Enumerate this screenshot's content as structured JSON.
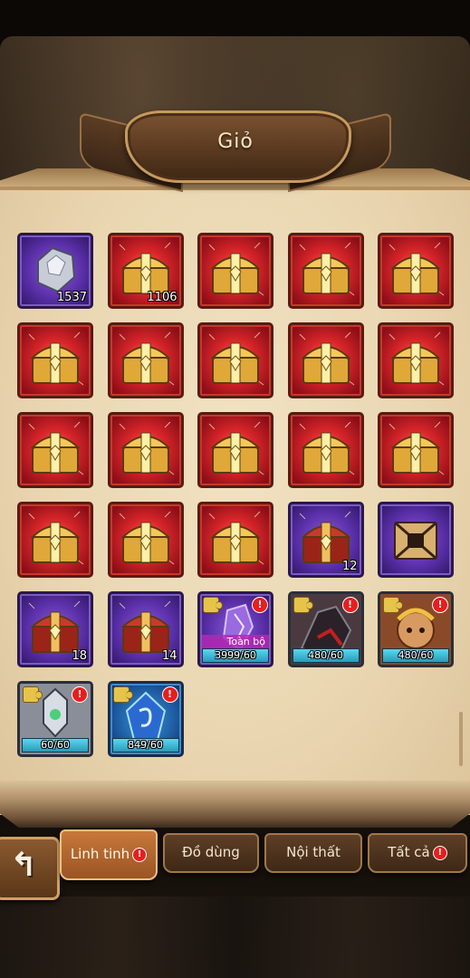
{
  "title": "Giỏ",
  "items": [
    {
      "kind": "gem",
      "count": "1537"
    },
    {
      "kind": "gold-chest",
      "count": "1106"
    },
    {
      "kind": "gold-chest",
      "count": ""
    },
    {
      "kind": "gold-chest",
      "count": ""
    },
    {
      "kind": "gold-chest",
      "count": ""
    },
    {
      "kind": "gold-chest",
      "count": ""
    },
    {
      "kind": "gold-chest",
      "count": ""
    },
    {
      "kind": "gold-chest",
      "count": ""
    },
    {
      "kind": "gold-chest",
      "count": ""
    },
    {
      "kind": "gold-chest",
      "count": ""
    },
    {
      "kind": "gold-chest",
      "count": ""
    },
    {
      "kind": "gold-chest",
      "count": ""
    },
    {
      "kind": "gold-chest",
      "count": ""
    },
    {
      "kind": "gold-chest",
      "count": ""
    },
    {
      "kind": "gold-chest",
      "count": ""
    },
    {
      "kind": "gold-chest",
      "count": ""
    },
    {
      "kind": "gold-chest",
      "count": ""
    },
    {
      "kind": "gold-chest",
      "count": ""
    },
    {
      "kind": "red-chest",
      "count": "12"
    },
    {
      "kind": "dark-chest",
      "count": ""
    },
    {
      "kind": "red-chest",
      "count": "18"
    },
    {
      "kind": "red-chest",
      "count": "14"
    },
    {
      "kind": "crystal-fragment",
      "count": "3999/60",
      "tag": "Toàn bộ"
    },
    {
      "kind": "hero-fragment-dark",
      "count": "480/60"
    },
    {
      "kind": "hero-fragment-monkey",
      "count": "480/60"
    },
    {
      "kind": "hero-fragment-knight",
      "count": "60/60"
    },
    {
      "kind": "rune-fragment",
      "count": "849/60"
    }
  ],
  "tabs": {
    "misc": "Linh tinh",
    "equipment": "Đồ dùng",
    "furniture": "Nội thất",
    "all": "Tất cả"
  },
  "alert_glyph": "!",
  "back_glyph": "↰"
}
